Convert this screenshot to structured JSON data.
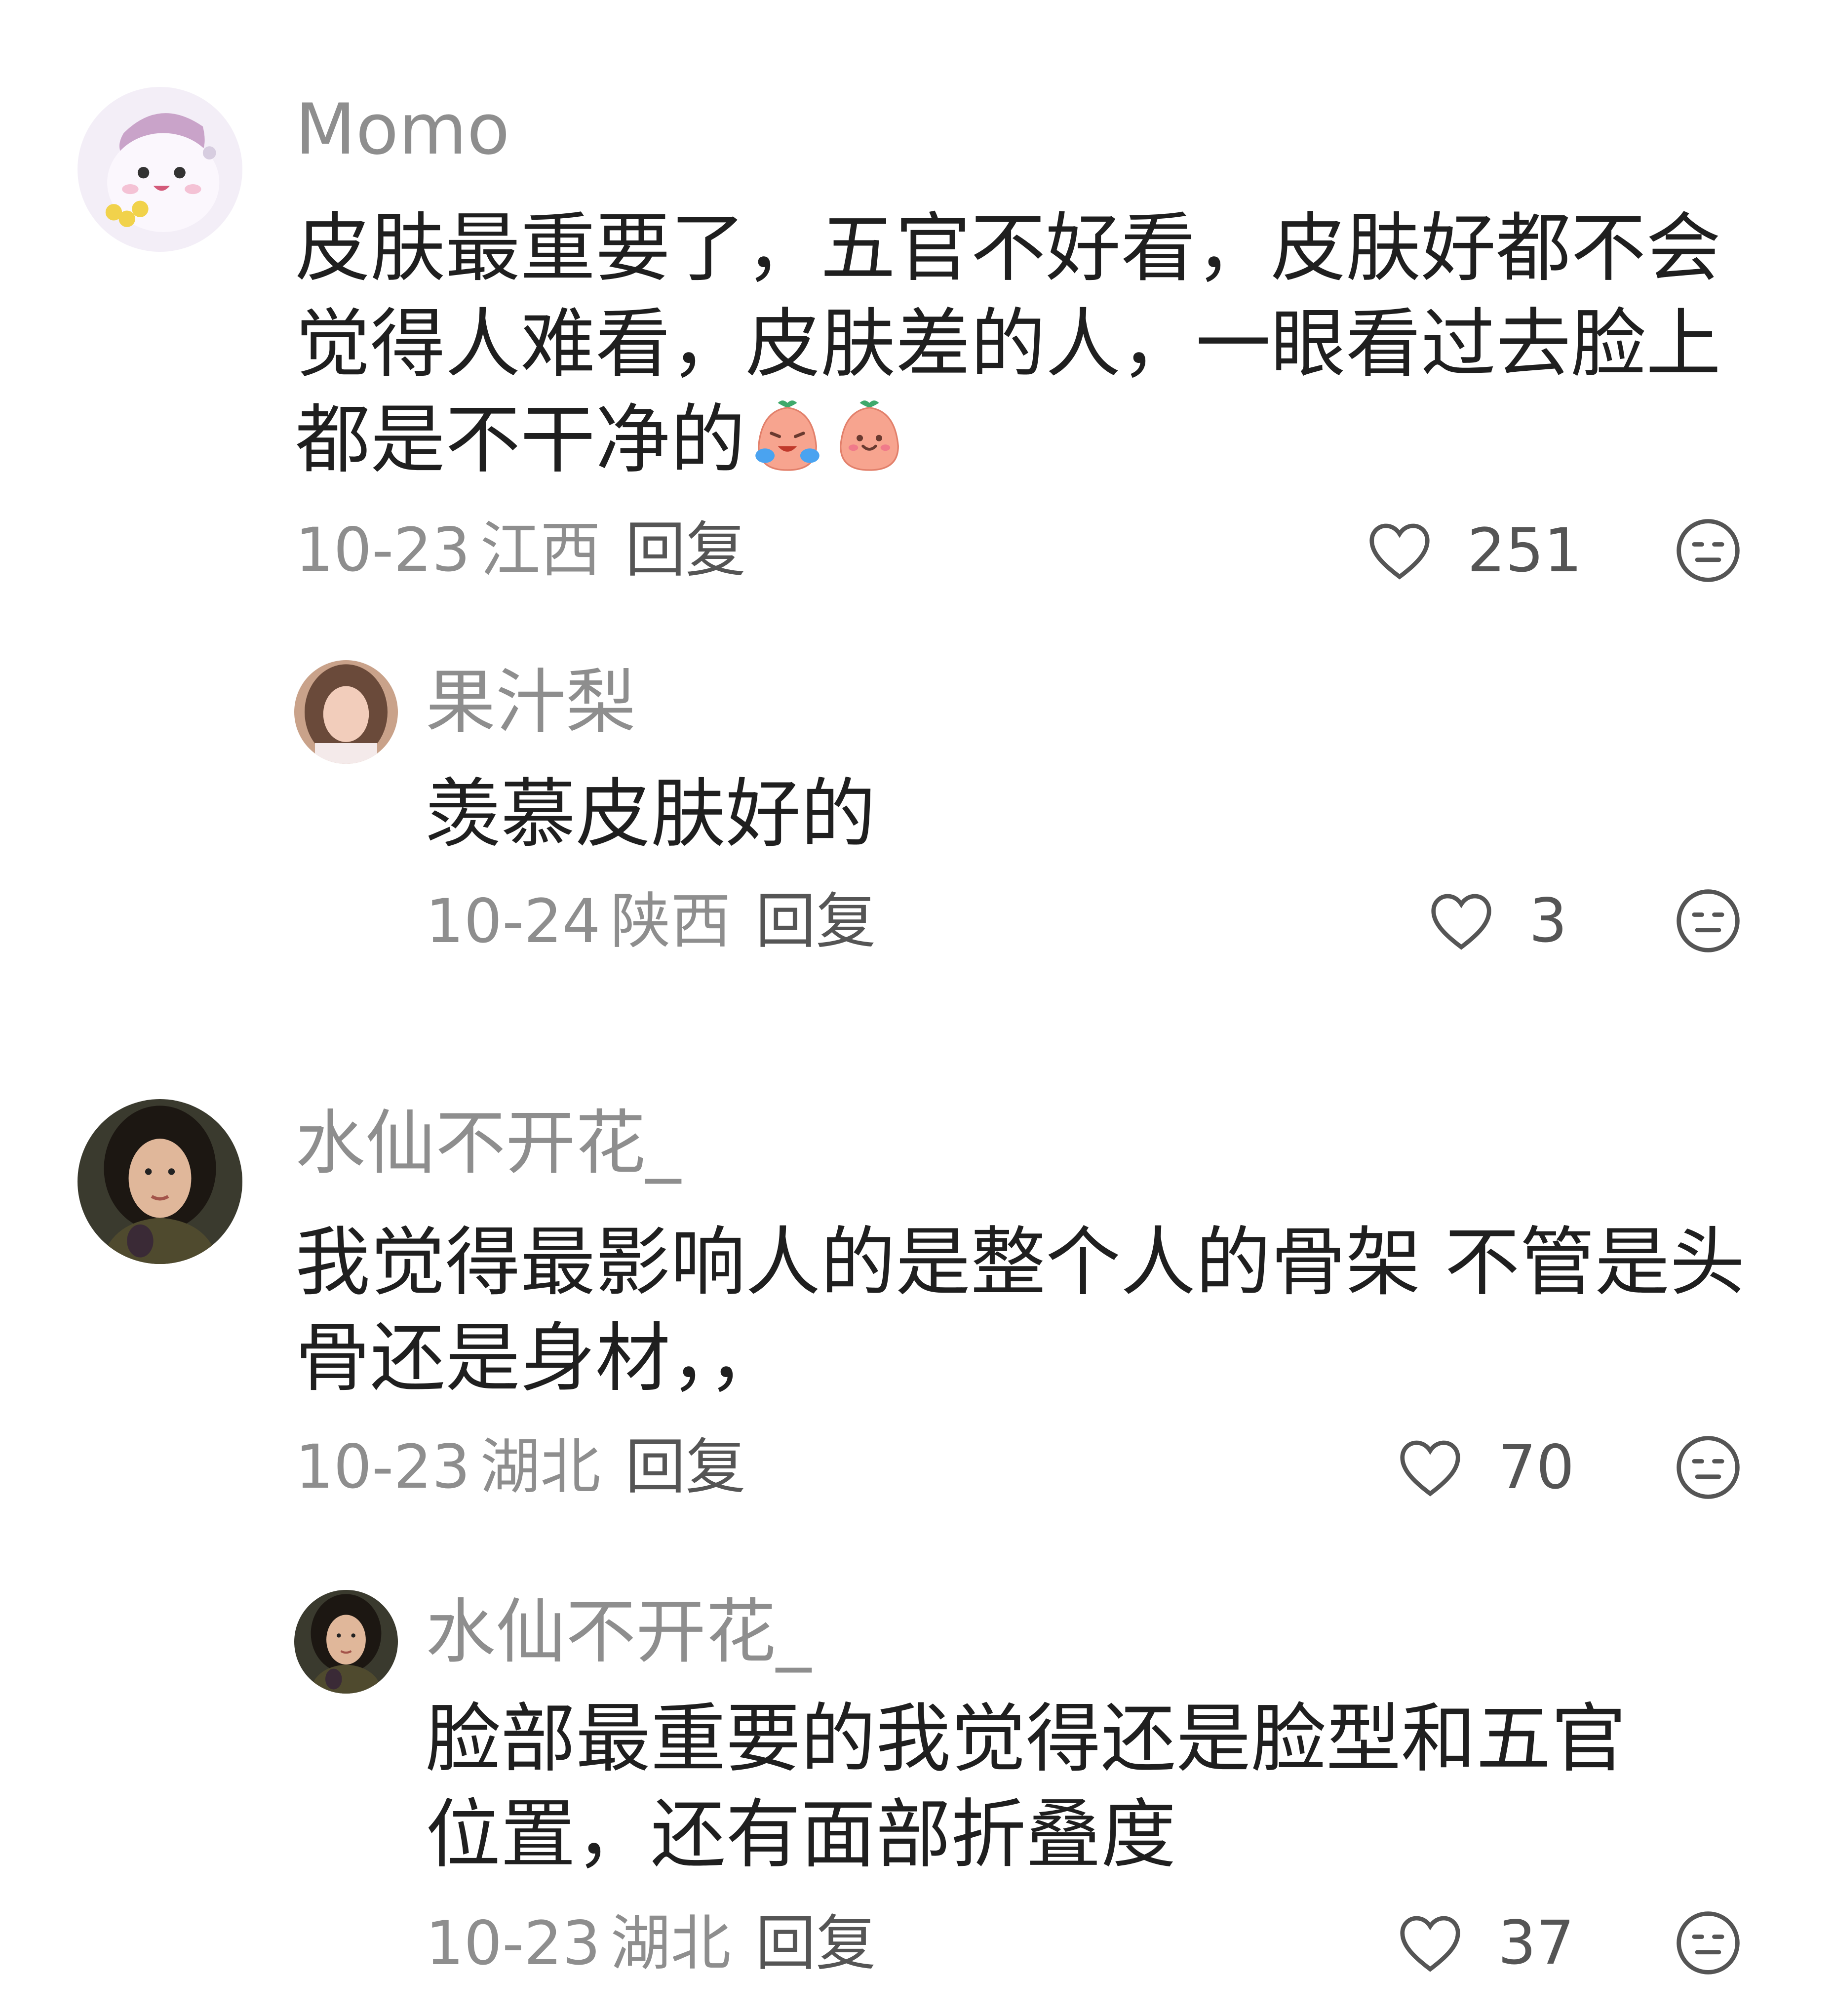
{
  "comments": [
    {
      "user": "Momo",
      "text": "皮肤最重要了，五官不好看，皮肤好都不会觉得人难看，皮肤差的人，一眼看过去脸上都是不干净的",
      "emoji": [
        "crying-peach-emoji",
        "smiling-peach-emoji"
      ],
      "date": "10-23",
      "location": "江西",
      "reply_label": "回复",
      "likes": "251",
      "reply": {
        "user": "果汁梨",
        "text": "羡慕皮肤好的",
        "date": "10-24",
        "location": "陕西",
        "reply_label": "回复",
        "likes": "3"
      }
    },
    {
      "user": "水仙不开花_",
      "text": "我觉得最影响人的是整个人的骨架 不管是头骨还是身材，，",
      "date": "10-23",
      "location": "湖北",
      "reply_label": "回复",
      "likes": "70",
      "reply": {
        "user": "水仙不开花_",
        "text": "脸部最重要的我觉得还是脸型和五官位置，还有面部折叠度",
        "date": "10-23",
        "location": "湖北",
        "reply_label": "回复",
        "likes": "37"
      }
    }
  ],
  "colors": {
    "name": "#8e8e8e",
    "text": "#1f1f1f",
    "meta": "#8e8e8e",
    "icon": "#555555"
  }
}
